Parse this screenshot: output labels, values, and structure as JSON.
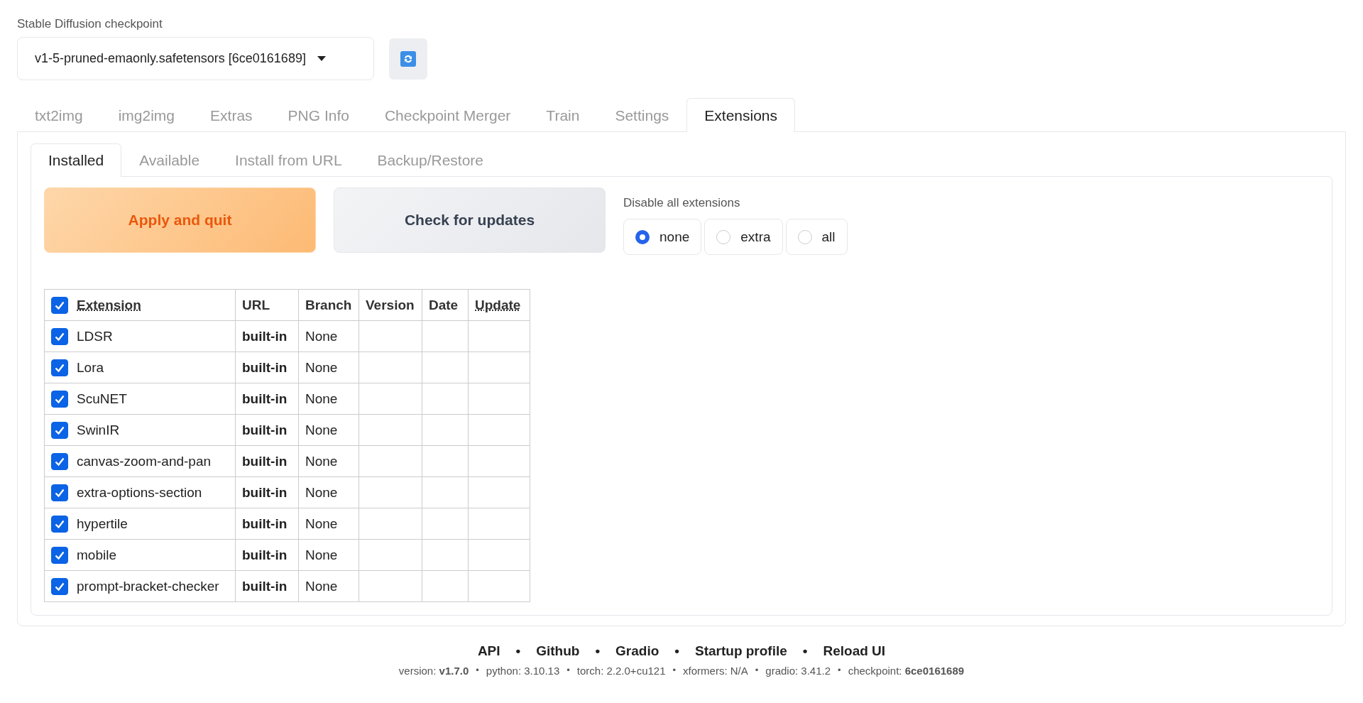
{
  "checkpoint": {
    "label": "Stable Diffusion checkpoint",
    "value": "v1-5-pruned-emaonly.safetensors [6ce0161689]"
  },
  "tabs": [
    {
      "label": "txt2img",
      "selected": false
    },
    {
      "label": "img2img",
      "selected": false
    },
    {
      "label": "Extras",
      "selected": false
    },
    {
      "label": "PNG Info",
      "selected": false
    },
    {
      "label": "Checkpoint Merger",
      "selected": false
    },
    {
      "label": "Train",
      "selected": false
    },
    {
      "label": "Settings",
      "selected": false
    },
    {
      "label": "Extensions",
      "selected": true
    }
  ],
  "subtabs": [
    {
      "label": "Installed",
      "selected": true
    },
    {
      "label": "Available",
      "selected": false
    },
    {
      "label": "Install from URL",
      "selected": false
    },
    {
      "label": "Backup/Restore",
      "selected": false
    }
  ],
  "buttons": [
    {
      "label": "Apply and quit",
      "kind": "primary"
    },
    {
      "label": "Check for updates",
      "kind": "secondary"
    }
  ],
  "disable_all": {
    "label": "Disable all extensions",
    "options": [
      {
        "label": "none",
        "selected": true
      },
      {
        "label": "extra",
        "selected": false
      },
      {
        "label": "all",
        "selected": false
      }
    ]
  },
  "table": {
    "all_checked": true,
    "columns": [
      {
        "label": "Extension",
        "dotted": true
      },
      {
        "label": "URL",
        "dotted": false
      },
      {
        "label": "Branch",
        "dotted": false
      },
      {
        "label": "Version",
        "dotted": false
      },
      {
        "label": "Date",
        "dotted": false
      },
      {
        "label": "Update",
        "dotted": true
      }
    ],
    "rows": [
      {
        "name": "LDSR",
        "checked": true,
        "url": "built-in",
        "branch": "None"
      },
      {
        "name": "Lora",
        "checked": true,
        "url": "built-in",
        "branch": "None"
      },
      {
        "name": "ScuNET",
        "checked": true,
        "url": "built-in",
        "branch": "None"
      },
      {
        "name": "SwinIR",
        "checked": true,
        "url": "built-in",
        "branch": "None"
      },
      {
        "name": "canvas-zoom-and-pan",
        "checked": true,
        "url": "built-in",
        "branch": "None"
      },
      {
        "name": "extra-options-section",
        "checked": true,
        "url": "built-in",
        "branch": "None"
      },
      {
        "name": "hypertile",
        "checked": true,
        "url": "built-in",
        "branch": "None"
      },
      {
        "name": "mobile",
        "checked": true,
        "url": "built-in",
        "branch": "None"
      },
      {
        "name": "prompt-bracket-checker",
        "checked": true,
        "url": "built-in",
        "branch": "None"
      }
    ]
  },
  "footer": {
    "links": [
      "API",
      "Github",
      "Gradio",
      "Startup profile",
      "Reload UI"
    ],
    "link_separators": [
      "•",
      "•",
      "•",
      "•"
    ],
    "info": [
      "version: **v1.7.0**",
      "python: 3.10.13",
      "torch: 2.2.0+cu121",
      "xformers: N/A",
      "gradio: 3.41.2",
      "checkpoint: **6ce0161689**"
    ],
    "info_separators": [
      "•",
      "•",
      "•",
      "•",
      "•"
    ]
  }
}
